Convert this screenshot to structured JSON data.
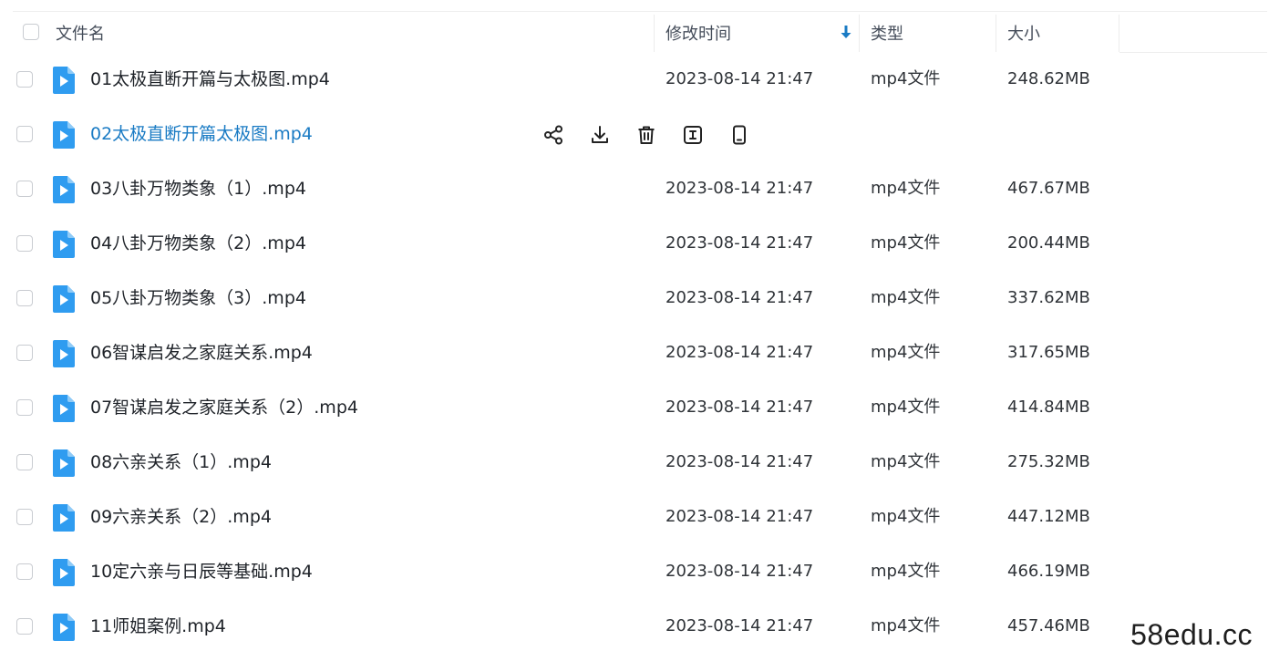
{
  "header": {
    "name_label": "文件名",
    "mtime_label": "修改时间",
    "type_label": "类型",
    "size_label": "大小"
  },
  "files": [
    {
      "name": "01太极直断开篇与太极图.mp4",
      "mtime": "2023-08-14 21:47",
      "type": "mp4文件",
      "size": "248.62MB"
    },
    {
      "name": "02太极直断开篇太极图.mp4",
      "mtime": "",
      "type": "",
      "size": ""
    },
    {
      "name": "03八卦万物类象（1）.mp4",
      "mtime": "2023-08-14 21:47",
      "type": "mp4文件",
      "size": "467.67MB"
    },
    {
      "name": "04八卦万物类象（2）.mp4",
      "mtime": "2023-08-14 21:47",
      "type": "mp4文件",
      "size": "200.44MB"
    },
    {
      "name": "05八卦万物类象（3）.mp4",
      "mtime": "2023-08-14 21:47",
      "type": "mp4文件",
      "size": "337.62MB"
    },
    {
      "name": "06智谋启发之家庭关系.mp4",
      "mtime": "2023-08-14 21:47",
      "type": "mp4文件",
      "size": "317.65MB"
    },
    {
      "name": "07智谋启发之家庭关系（2）.mp4",
      "mtime": "2023-08-14 21:47",
      "type": "mp4文件",
      "size": "414.84MB"
    },
    {
      "name": "08六亲关系（1）.mp4",
      "mtime": "2023-08-14 21:47",
      "type": "mp4文件",
      "size": "275.32MB"
    },
    {
      "name": "09六亲关系（2）.mp4",
      "mtime": "2023-08-14 21:47",
      "type": "mp4文件",
      "size": "447.12MB"
    },
    {
      "name": "10定六亲与日辰等基础.mp4",
      "mtime": "2023-08-14 21:47",
      "type": "mp4文件",
      "size": "466.19MB"
    },
    {
      "name": "11师姐案例.mp4",
      "mtime": "2023-08-14 21:47",
      "type": "mp4文件",
      "size": "457.46MB"
    }
  ],
  "hover_row_index": 1,
  "hover_actions": [
    "share-icon",
    "download-icon",
    "trash-icon",
    "rename-icon",
    "phone-icon"
  ],
  "icons": {
    "file": "video-file-icon",
    "sort": "sort-descending-icon"
  },
  "colors": {
    "accent": "#1a7bc4",
    "file_icon": "#2f9cf0",
    "text": "#1f2329",
    "header_text": "#454d5a"
  },
  "watermark": "58edu.cc"
}
